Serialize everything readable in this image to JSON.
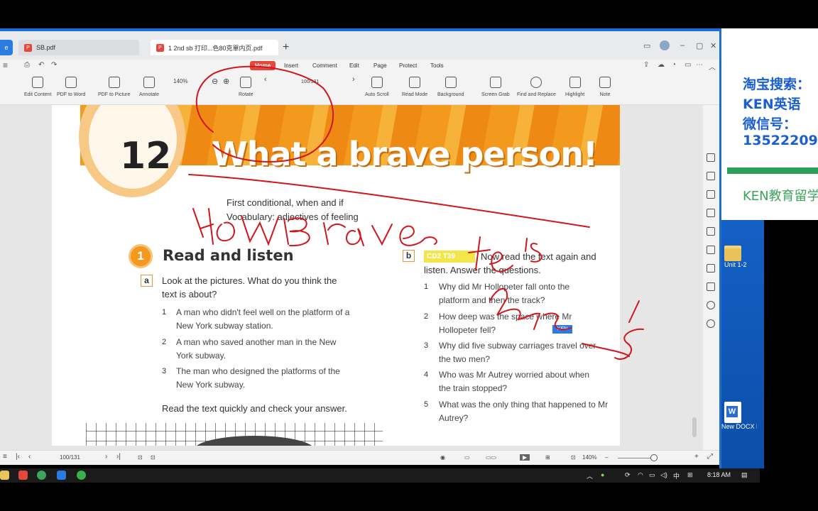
{
  "window": {
    "tabs": [
      {
        "label": "SB.pdf",
        "active": false
      },
      {
        "label": "1 2nd sb 打印...色80克單内页.pdf",
        "active": true
      }
    ],
    "new_tab": "+"
  },
  "menu": {
    "items": [
      "Home",
      "Insert",
      "Comment",
      "Edit",
      "Page",
      "Protect",
      "Tools"
    ]
  },
  "toolbar": {
    "tools": [
      "Edit Content",
      "PDF to Word",
      "PDF to Picture",
      "Annotate",
      "Rotate",
      "Auto Scroll",
      "Read Mode",
      "Background",
      "Screen Grab",
      "Find and Replace",
      "Highlight",
      "Note"
    ],
    "zoom": "140%",
    "page_indicator": "100/131"
  },
  "document": {
    "unit_number": "12",
    "unit_title": "What a brave person!",
    "subtitle_line1": "First conditional, when and if",
    "subtitle_line2": "Vocabulary: adjectives of feeling",
    "section_number": "1",
    "section_title": "Read and listen",
    "part_a": {
      "letter": "a",
      "prompt": "Look at the pictures. What do you think the text is about?",
      "options": [
        "A man who didn't feel well on the platform of a New York subway station.",
        "A man who saved another man in the New York subway.",
        "The man who designed the platforms of the New York subway."
      ],
      "instruction": "Read the text quickly and check your answer."
    },
    "part_b": {
      "letter": "b",
      "track": "CD2 T39",
      "prompt": "Now read the text again and listen. Answer the questions.",
      "questions": [
        "Why did Mr Hollopeter fall onto the platform and then the track?",
        "How deep was the space where Mr Hollopeter fell?",
        "Why did five subway carriages travel over the two men?",
        "Who was Mr Autrey worried about when the train stopped?",
        "What was the only thing that happened to Mr Autrey?"
      ]
    },
    "tag": "KEN"
  },
  "statusbar": {
    "page": "100/131",
    "zoom": "140%"
  },
  "desktop": {
    "ad_lines": [
      "淘宝搜索：",
      "KEN英语",
      "微信号：",
      "13522209"
    ],
    "ad_footer": "KEN教育留学",
    "icons": [
      "Unit 1-2",
      "New DOCX Document.d..."
    ]
  },
  "taskbar": {
    "time": "8:18 AM",
    "ime": "中"
  },
  "colors": {
    "accent": "#e5483a",
    "banner": "#f39a1e",
    "ink": "#d1161b",
    "desktop_blue": "#1f6fd1"
  }
}
